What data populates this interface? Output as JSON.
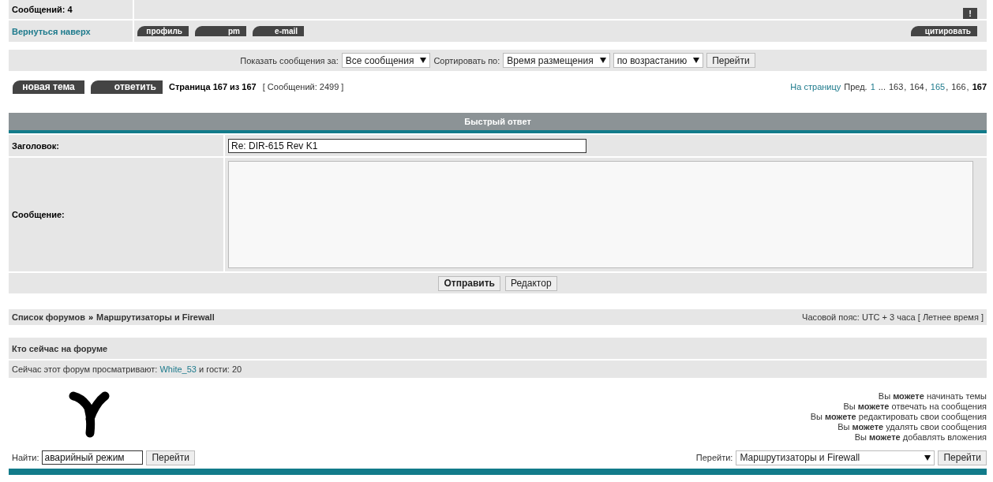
{
  "post": {
    "stats": "Сообщений: 4",
    "report": "!",
    "back_to_top": "Вернуться наверх",
    "buttons": [
      "профиль",
      "pm",
      "e-mail"
    ],
    "quote": "цитировать"
  },
  "sort_bar": {
    "show_label": "Показать сообщения за:",
    "show_value": "Все сообщения",
    "sort_label": "Сортировать по:",
    "sort_value": "Время размещения",
    "order_value": "по возрастанию",
    "go": "Перейти"
  },
  "actions": {
    "buttons": [
      "новая тема",
      "ответить"
    ],
    "page": "Страница 167 из 167",
    "count": "[ Сообщений: 2499 ]"
  },
  "pagination": {
    "label": "На страницу",
    "prev": "Пред.",
    "pages": [
      {
        "text": "1",
        "kind": "link"
      },
      {
        "text": "...",
        "kind": "ellipsis"
      },
      {
        "text": "163",
        "kind": "page",
        "sep": ","
      },
      {
        "text": "164",
        "kind": "page",
        "sep": ","
      },
      {
        "text": "165",
        "kind": "link",
        "sep": ","
      },
      {
        "text": "166",
        "kind": "page",
        "sep": ","
      },
      {
        "text": "167",
        "kind": "current"
      }
    ]
  },
  "quick_reply": {
    "title": "Быстрый ответ",
    "subject_label": "Заголовок:",
    "subject_value": "Re: DIR-615 Rev K1",
    "message_label": "Сообщение:",
    "buttons": [
      {
        "label": "Отправить",
        "primary": true
      },
      {
        "label": "Редактор",
        "primary": false
      }
    ]
  },
  "breadcrumb": {
    "items": [
      "Список форумов",
      "Маршрутизаторы и Firewall"
    ],
    "separator": "»",
    "timezone": "Часовой пояс: UTC + 3 часа [ Летнее время ]"
  },
  "who_online": {
    "title": "Кто сейчас на форуме",
    "prefix": "Сейчас этот форум просматривают:",
    "user": "White_53",
    "suffix": "и гости: 20"
  },
  "permissions": [
    "Вы **можете** начинать темы",
    "Вы **можете** отвечать на сообщения",
    "Вы **можете** редактировать свои сообщения",
    "Вы **можете** удалять свои сообщения",
    "Вы **можете** добавлять вложения"
  ],
  "search": {
    "label": "Найти:",
    "value": "аварийный режим",
    "button": "Перейти"
  },
  "jump": {
    "label": "Перейти:",
    "value": "Маршрутизаторы и Firewall",
    "button": "Перейти"
  }
}
